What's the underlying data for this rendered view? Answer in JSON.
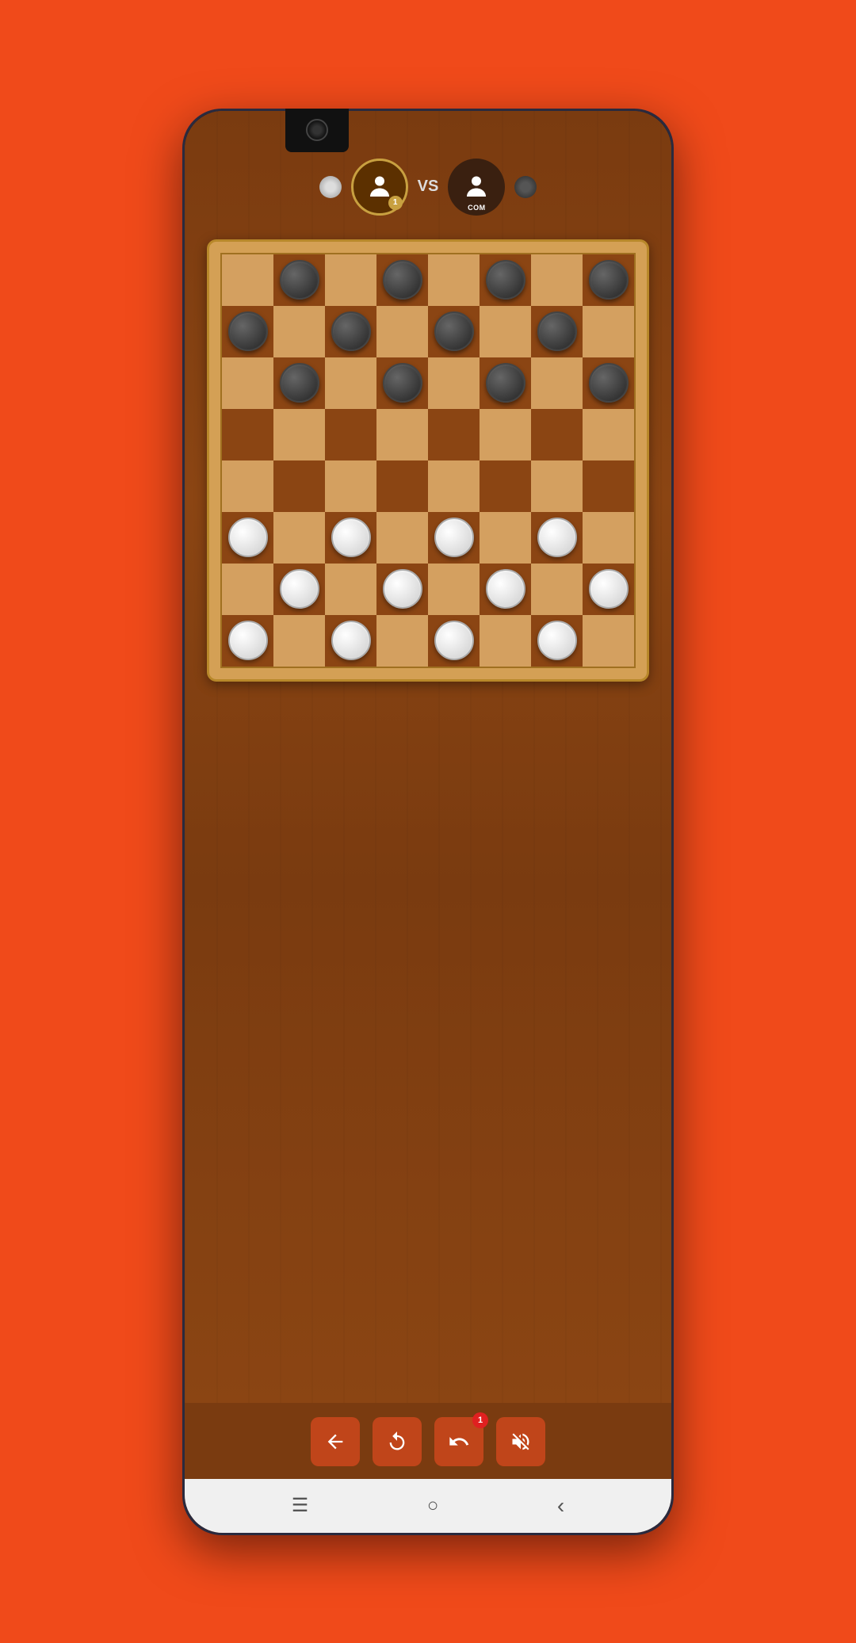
{
  "background_color": "#f04a1a",
  "players": {
    "player1": {
      "label": "Player 1",
      "badge": "1",
      "token_color": "white"
    },
    "vs_label": "VS",
    "player2": {
      "label": "COM",
      "token_color": "dark"
    }
  },
  "board": {
    "size": 8,
    "pieces": [
      {
        "row": 0,
        "col": 1,
        "color": "black"
      },
      {
        "row": 0,
        "col": 3,
        "color": "black"
      },
      {
        "row": 0,
        "col": 5,
        "color": "black"
      },
      {
        "row": 0,
        "col": 7,
        "color": "black"
      },
      {
        "row": 1,
        "col": 0,
        "color": "black"
      },
      {
        "row": 1,
        "col": 2,
        "color": "black"
      },
      {
        "row": 1,
        "col": 4,
        "color": "black"
      },
      {
        "row": 1,
        "col": 6,
        "color": "black"
      },
      {
        "row": 2,
        "col": 1,
        "color": "black"
      },
      {
        "row": 2,
        "col": 3,
        "color": "black"
      },
      {
        "row": 2,
        "col": 5,
        "color": "black"
      },
      {
        "row": 2,
        "col": 7,
        "color": "black"
      },
      {
        "row": 5,
        "col": 0,
        "color": "white"
      },
      {
        "row": 5,
        "col": 2,
        "color": "white"
      },
      {
        "row": 5,
        "col": 4,
        "color": "white"
      },
      {
        "row": 5,
        "col": 6,
        "color": "white"
      },
      {
        "row": 6,
        "col": 1,
        "color": "white"
      },
      {
        "row": 6,
        "col": 3,
        "color": "white"
      },
      {
        "row": 6,
        "col": 5,
        "color": "white"
      },
      {
        "row": 6,
        "col": 7,
        "color": "white"
      },
      {
        "row": 7,
        "col": 0,
        "color": "white"
      },
      {
        "row": 7,
        "col": 2,
        "color": "white"
      },
      {
        "row": 7,
        "col": 4,
        "color": "white"
      },
      {
        "row": 7,
        "col": 6,
        "color": "white"
      }
    ]
  },
  "toolbar": {
    "back_label": "←",
    "restart_label": "↺",
    "undo_label": "↩",
    "undo_badge": "1",
    "sound_label": "🔇"
  },
  "navbar": {
    "menu_icon": "☰",
    "home_icon": "○",
    "back_icon": "‹"
  }
}
